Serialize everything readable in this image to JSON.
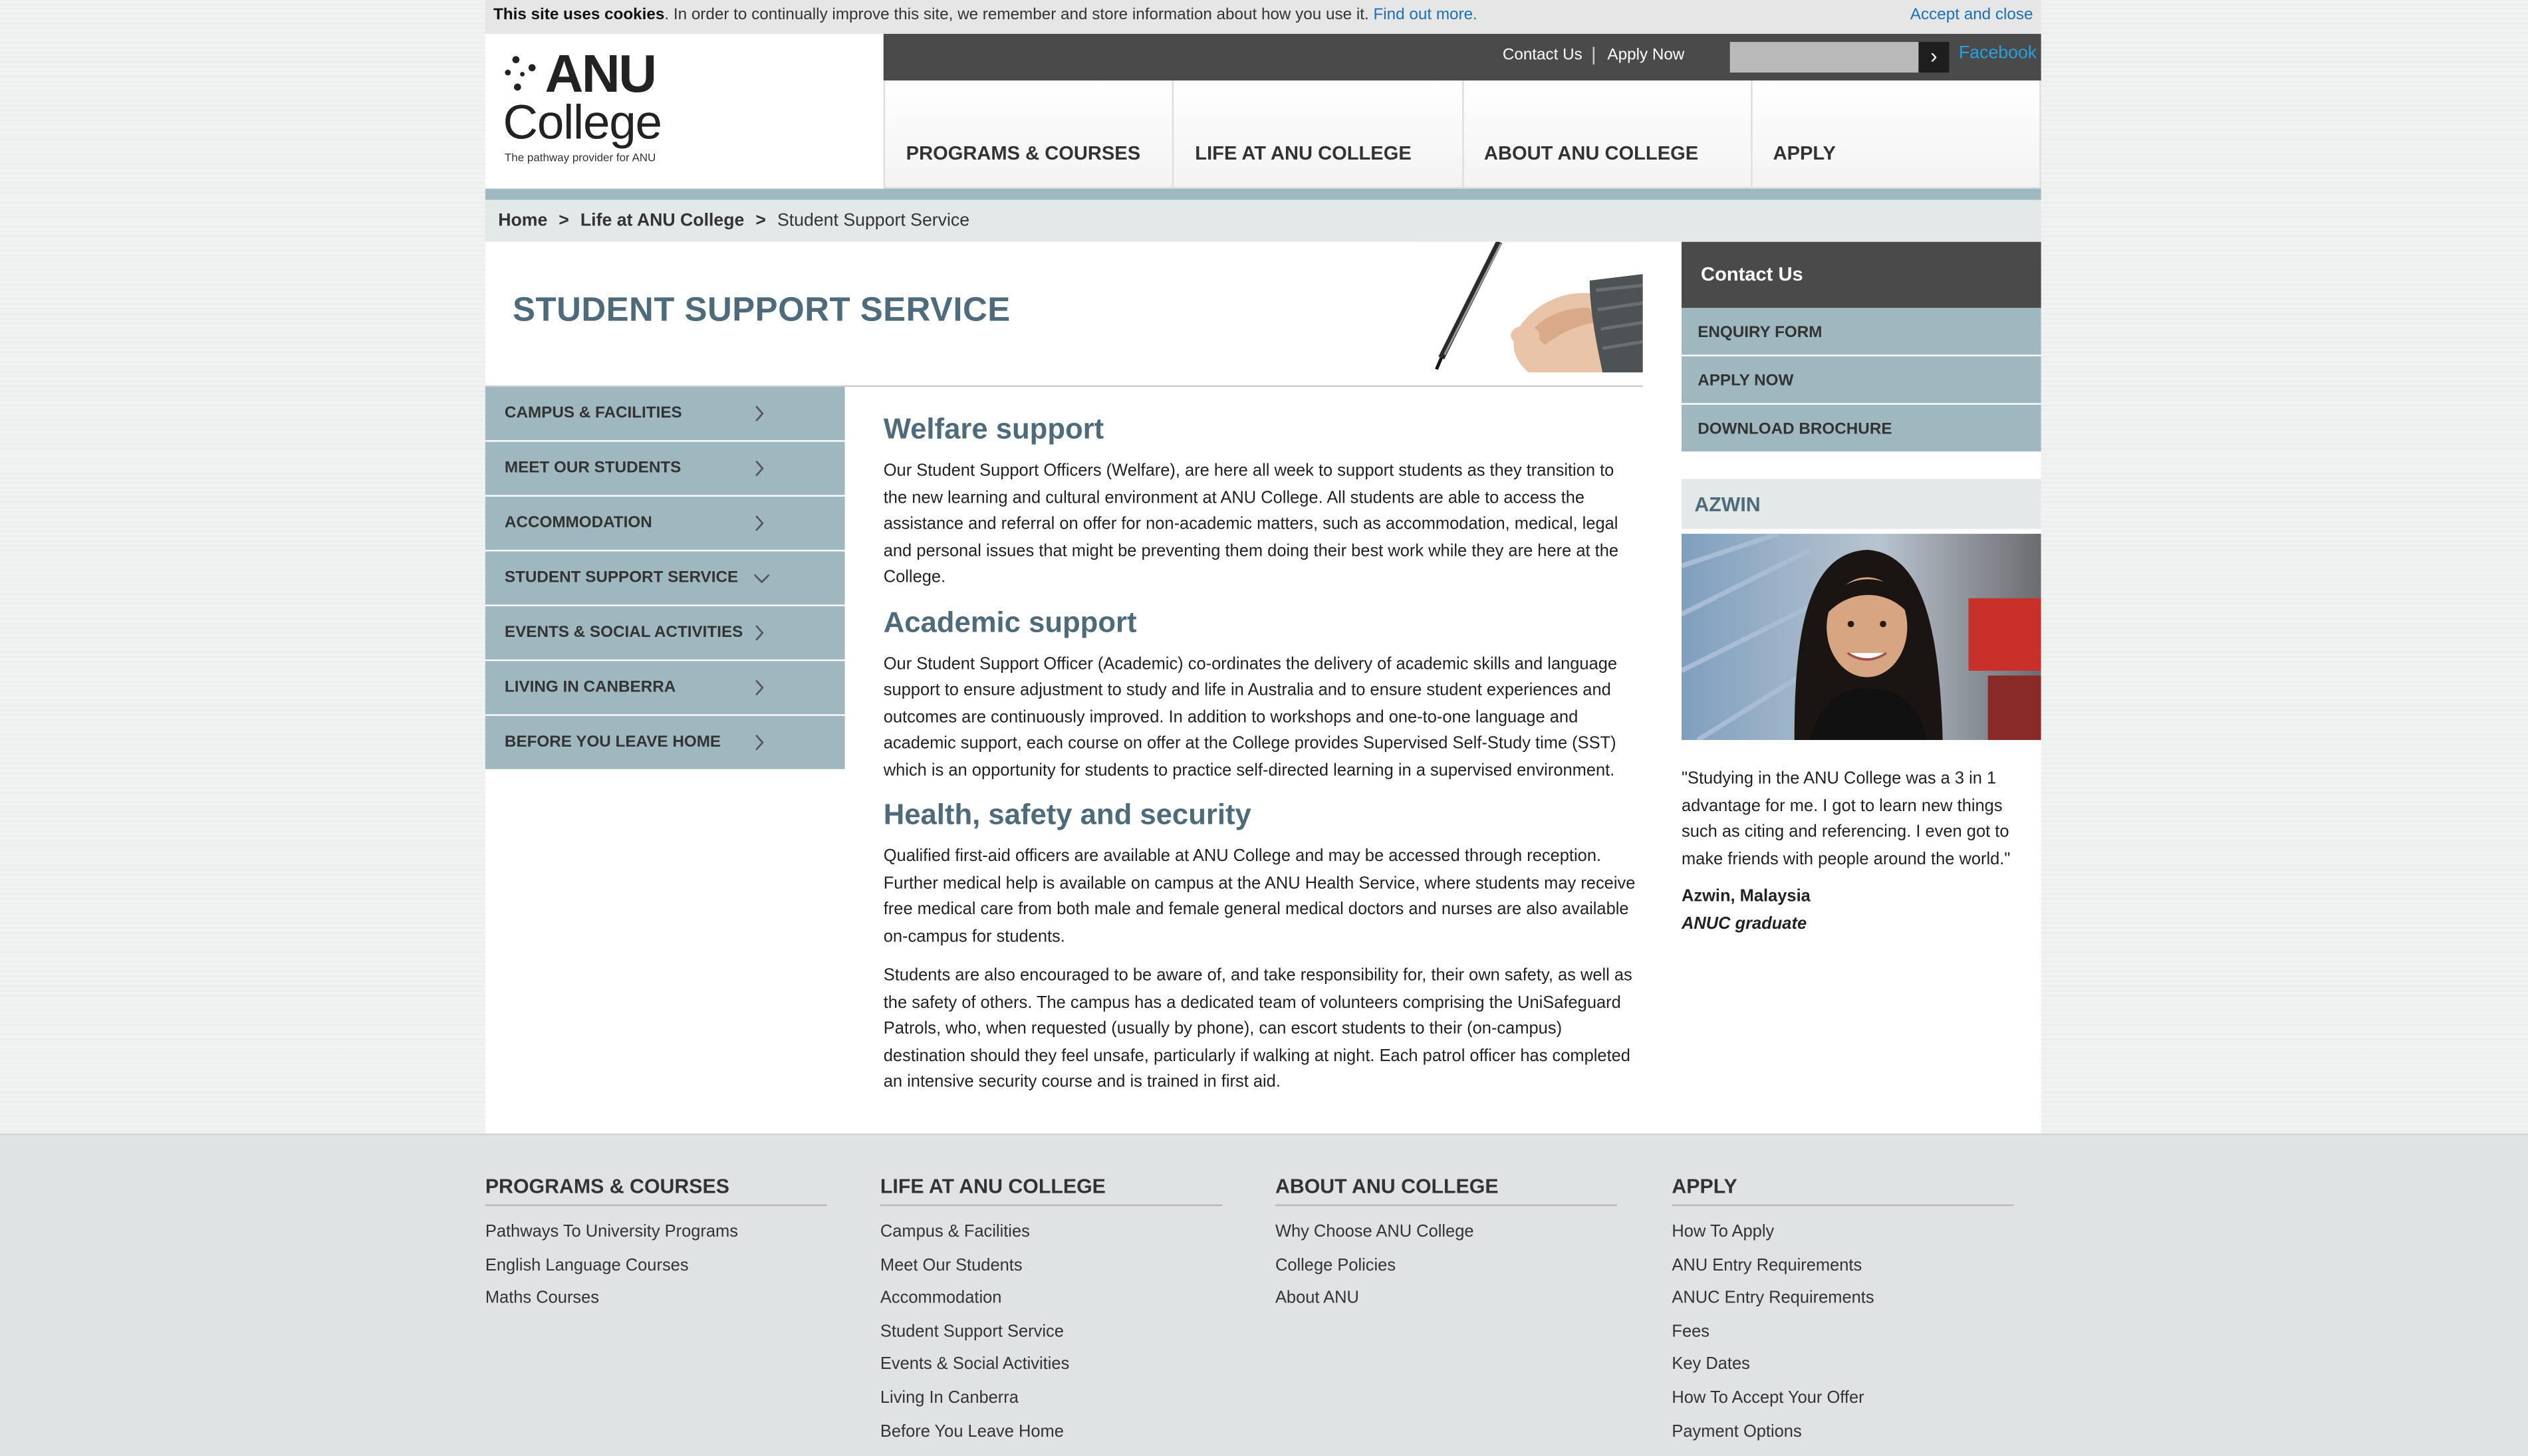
{
  "cookie": {
    "bold": "This site uses cookies",
    "text": ". In order to continually improve this site, we remember and store information about how you use it.",
    "find_out": "Find out more.",
    "accept": "Accept and close"
  },
  "logo": {
    "anu": "ANU",
    "college": "College",
    "tagline": "The pathway provider for ANU"
  },
  "topbar": {
    "contact": "Contact Us",
    "apply": "Apply Now",
    "search_placeholder": "",
    "search_button": "›",
    "facebook": "Facebook"
  },
  "nav": {
    "programs": "PROGRAMS & COURSES",
    "life": "LIFE AT ANU COLLEGE",
    "about": "ABOUT ANU COLLEGE",
    "apply": "APPLY"
  },
  "breadcrumb": {
    "home": "Home",
    "sep": ">",
    "life": "Life at ANU College",
    "current": "Student Support Service"
  },
  "page_title": "STUDENT SUPPORT SERVICE",
  "subnav": {
    "items": [
      {
        "label": "CAMPUS & FACILITIES"
      },
      {
        "label": "MEET OUR STUDENTS"
      },
      {
        "label": "ACCOMMODATION"
      },
      {
        "label": "STUDENT SUPPORT SERVICE"
      },
      {
        "label": "EVENTS & SOCIAL ACTIVITIES"
      },
      {
        "label": "LIVING IN CANBERRA"
      },
      {
        "label": "BEFORE YOU LEAVE HOME"
      }
    ],
    "expanded_index": 3
  },
  "content": {
    "welfare_h": "Welfare support",
    "welfare_p": "Our Student Support Officers (Welfare), are here all week to support students as they transition to the new learning and cultural environment at ANU College. All students are able to access the assistance and referral on offer for non-academic matters, such as accommodation, medical, legal and personal issues that might be preventing them doing their best work while they are here at the College.",
    "academic_h": "Academic support",
    "academic_p": "Our Student Support Officer (Academic) co-ordinates the delivery of academic skills and language support to ensure adjustment to study and life in Australia and to ensure student experiences and outcomes are continuously improved. In addition to workshops and one-to-one language and academic support, each course on offer at the College provides Supervised Self-Study time (SST) which is an opportunity for students to practice self-directed learning in a supervised environment.",
    "health_h": "Health, safety and security",
    "health_p1": "Qualified first-aid officers are available at ANU College and may be accessed through reception. Further medical help is available on campus at the ANU Health Service, where students may receive free medical care from both male and female general medical doctors and nurses are also available on-campus for students.",
    "health_p2": "Students are also encouraged to be aware of, and take responsibility for, their own safety, as well as the safety of others. The campus has a dedicated team of volunteers comprising the UniSafeguard Patrols, who, when requested (usually by phone), can escort students to their (on-campus) destination should they feel unsafe, particularly if walking at night. Each patrol officer has completed an intensive security course and is trained in first aid."
  },
  "sidebar": {
    "contact_title": "Contact Us",
    "links": [
      "ENQUIRY FORM",
      "APPLY NOW",
      "DOWNLOAD BROCHURE"
    ],
    "profile_title": "AZWIN",
    "quote": "\"Studying in the ANU College was a 3 in 1 advantage for me. I got to learn new things such as citing and referencing. I even got to make friends with people around the world.\"",
    "name": "Azwin, Malaysia",
    "role": "ANUC graduate"
  },
  "footer": {
    "programs": {
      "title": "PROGRAMS & COURSES",
      "links": [
        "Pathways To University Programs",
        "English Language Courses",
        "Maths Courses"
      ]
    },
    "life": {
      "title": "LIFE AT ANU COLLEGE",
      "links": [
        "Campus & Facilities",
        "Meet Our Students",
        "Accommodation",
        "Student Support Service",
        "Events & Social Activities",
        "Living In Canberra",
        "Before You Leave Home"
      ]
    },
    "about": {
      "title": "ABOUT ANU COLLEGE",
      "links": [
        "Why Choose ANU College",
        "College Policies",
        "About ANU"
      ]
    },
    "apply": {
      "title": "APPLY",
      "links": [
        "How To Apply",
        "ANU Entry Requirements",
        "ANUC Entry Requirements",
        "Fees",
        "Key Dates",
        "How To Accept Your Offer",
        "Payment Options"
      ]
    }
  },
  "colors": {
    "accent_blue_gray": "#9fb8c0",
    "heading": "#4d6b7a",
    "dark_bar": "#4a4a4a",
    "link": "#1a6fb5"
  }
}
